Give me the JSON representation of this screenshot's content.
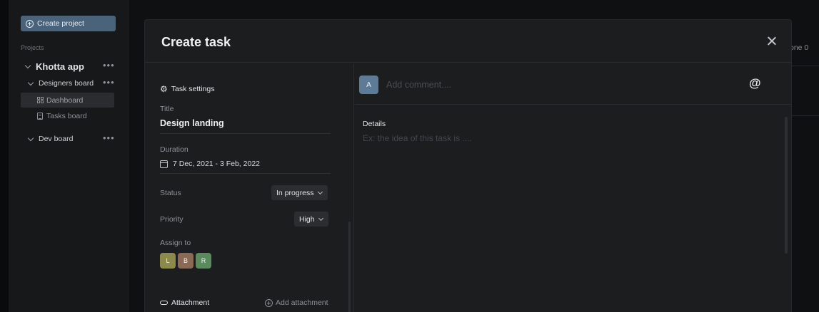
{
  "sidebar": {
    "create_project_label": "Create project",
    "projects_heading": "Projects",
    "project_name": "Khotta app",
    "designers_board": "Designers board",
    "dashboard": "Dashboard",
    "tasks_board": "Tasks board",
    "dev_board": "Dev board",
    "more_dots": "•••"
  },
  "background": {
    "right_text": "one  0"
  },
  "modal": {
    "title": "Create task",
    "task_settings": "Task settings",
    "title_label": "Title",
    "title_value": "Design landing",
    "duration_label": "Duration",
    "duration_value": "7 Dec, 2021 - 3 Feb, 2022",
    "status_label": "Status",
    "status_value": "In progress",
    "priority_label": "Priority",
    "priority_value": "High",
    "assign_label": "Assign to",
    "assignees": [
      {
        "initial": "L",
        "color": "#8c8a4a"
      },
      {
        "initial": "B",
        "color": "#8a6a55"
      },
      {
        "initial": "R",
        "color": "#5b8a5e"
      }
    ],
    "attachment_label": "Attachment",
    "add_attachment": "Add attachment",
    "comment": {
      "avatar_initial": "A",
      "placeholder": "Add comment....",
      "at_symbol": "@"
    },
    "details_label": "Details",
    "details_placeholder": "Ex: the idea of this task is ...."
  }
}
